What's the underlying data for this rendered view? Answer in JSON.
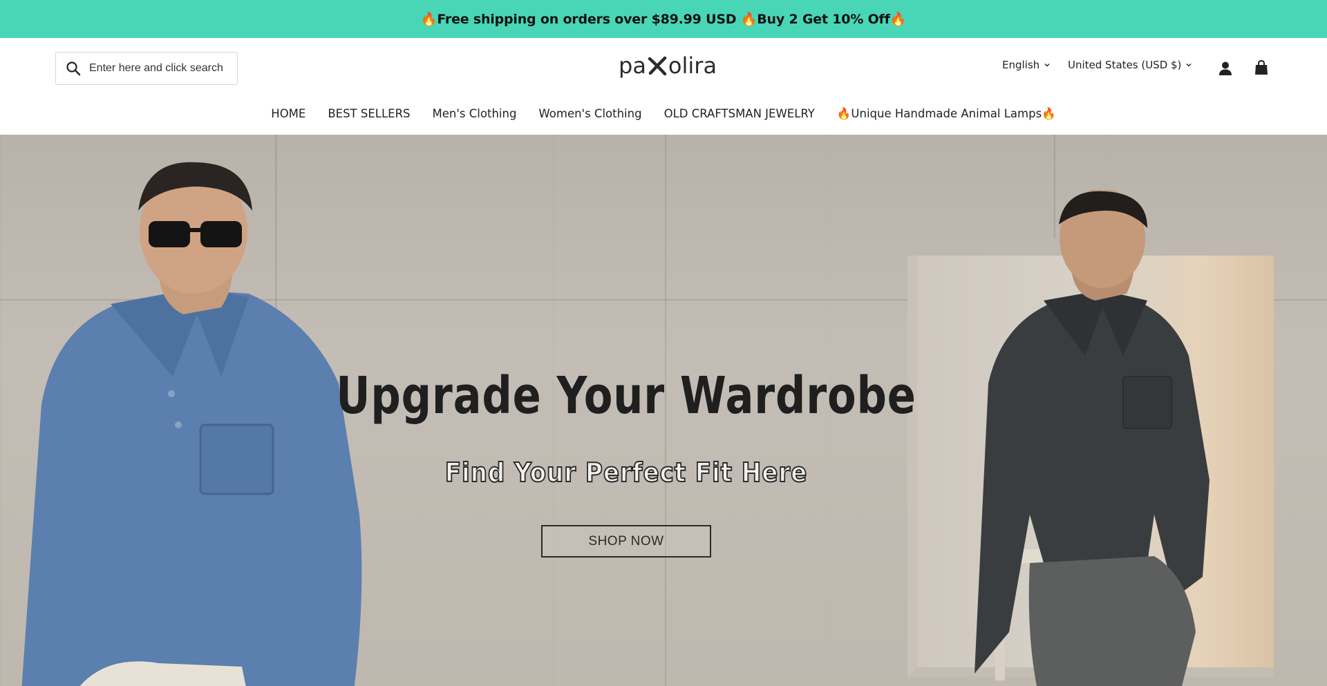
{
  "announcement": {
    "text": "🔥Free shipping on orders over $89.99 USD 🔥Buy 2 Get 10% Off🔥",
    "bg_color": "#48d6b6"
  },
  "header": {
    "search": {
      "placeholder": "Enter here and click search",
      "icon": "search-icon"
    },
    "logo": {
      "left": "pa",
      "right": "olira",
      "mark_icon": "x-mark-icon"
    },
    "language": {
      "label": "English",
      "icon": "chevron-down-icon"
    },
    "currency": {
      "label": "United States (USD $)",
      "icon": "chevron-down-icon"
    },
    "account_icon": "account-icon",
    "cart_icon": "shopping-bag-icon"
  },
  "nav": {
    "items": [
      {
        "label": "HOME"
      },
      {
        "label": "BEST SELLERS"
      },
      {
        "label": "Men's Clothing"
      },
      {
        "label": "Women's Clothing"
      },
      {
        "label": "OLD CRAFTSMAN JEWELRY"
      },
      {
        "label": "🔥Unique Handmade Animal Lamps🔥"
      }
    ]
  },
  "hero": {
    "title": "Upgrade Your Wardrobe",
    "subtitle": "Find Your Perfect Fit Here",
    "cta_label": "SHOP NOW",
    "colors": {
      "left_shirt": "#5b7fae",
      "right_shirt": "#3a3d40",
      "wall": "#bfb9b0"
    }
  }
}
